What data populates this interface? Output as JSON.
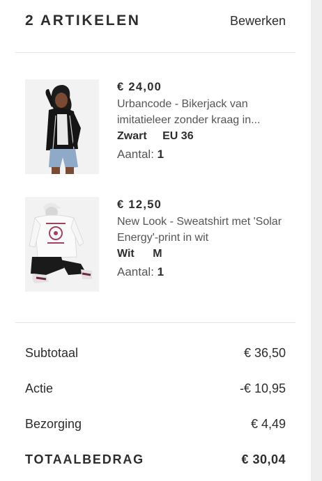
{
  "header": {
    "title": "2 ARTIKELEN",
    "edit_label": "Bewerken"
  },
  "items": [
    {
      "price": "€ 24,00",
      "name": "Urbancode - Bikerjack van imitatieleer zonder kraag in...",
      "color": "Zwart",
      "size": "EU 36",
      "qty_label": "Aantal:",
      "qty": "1"
    },
    {
      "price": "€ 12,50",
      "name": "New Look - Sweatshirt met 'Solar Energy'-print in wit",
      "color": "Wit",
      "size": "M",
      "qty_label": "Aantal:",
      "qty": "1"
    }
  ],
  "summary": {
    "subtotal_label": "Subtotaal",
    "subtotal_value": "€ 36,50",
    "discount_label": "Actie",
    "discount_value": "-€ 10,95",
    "shipping_label": "Bezorging",
    "shipping_value": "€ 4,49",
    "total_label": "TOTAALBEDRAG",
    "total_value": "€ 30,04"
  }
}
